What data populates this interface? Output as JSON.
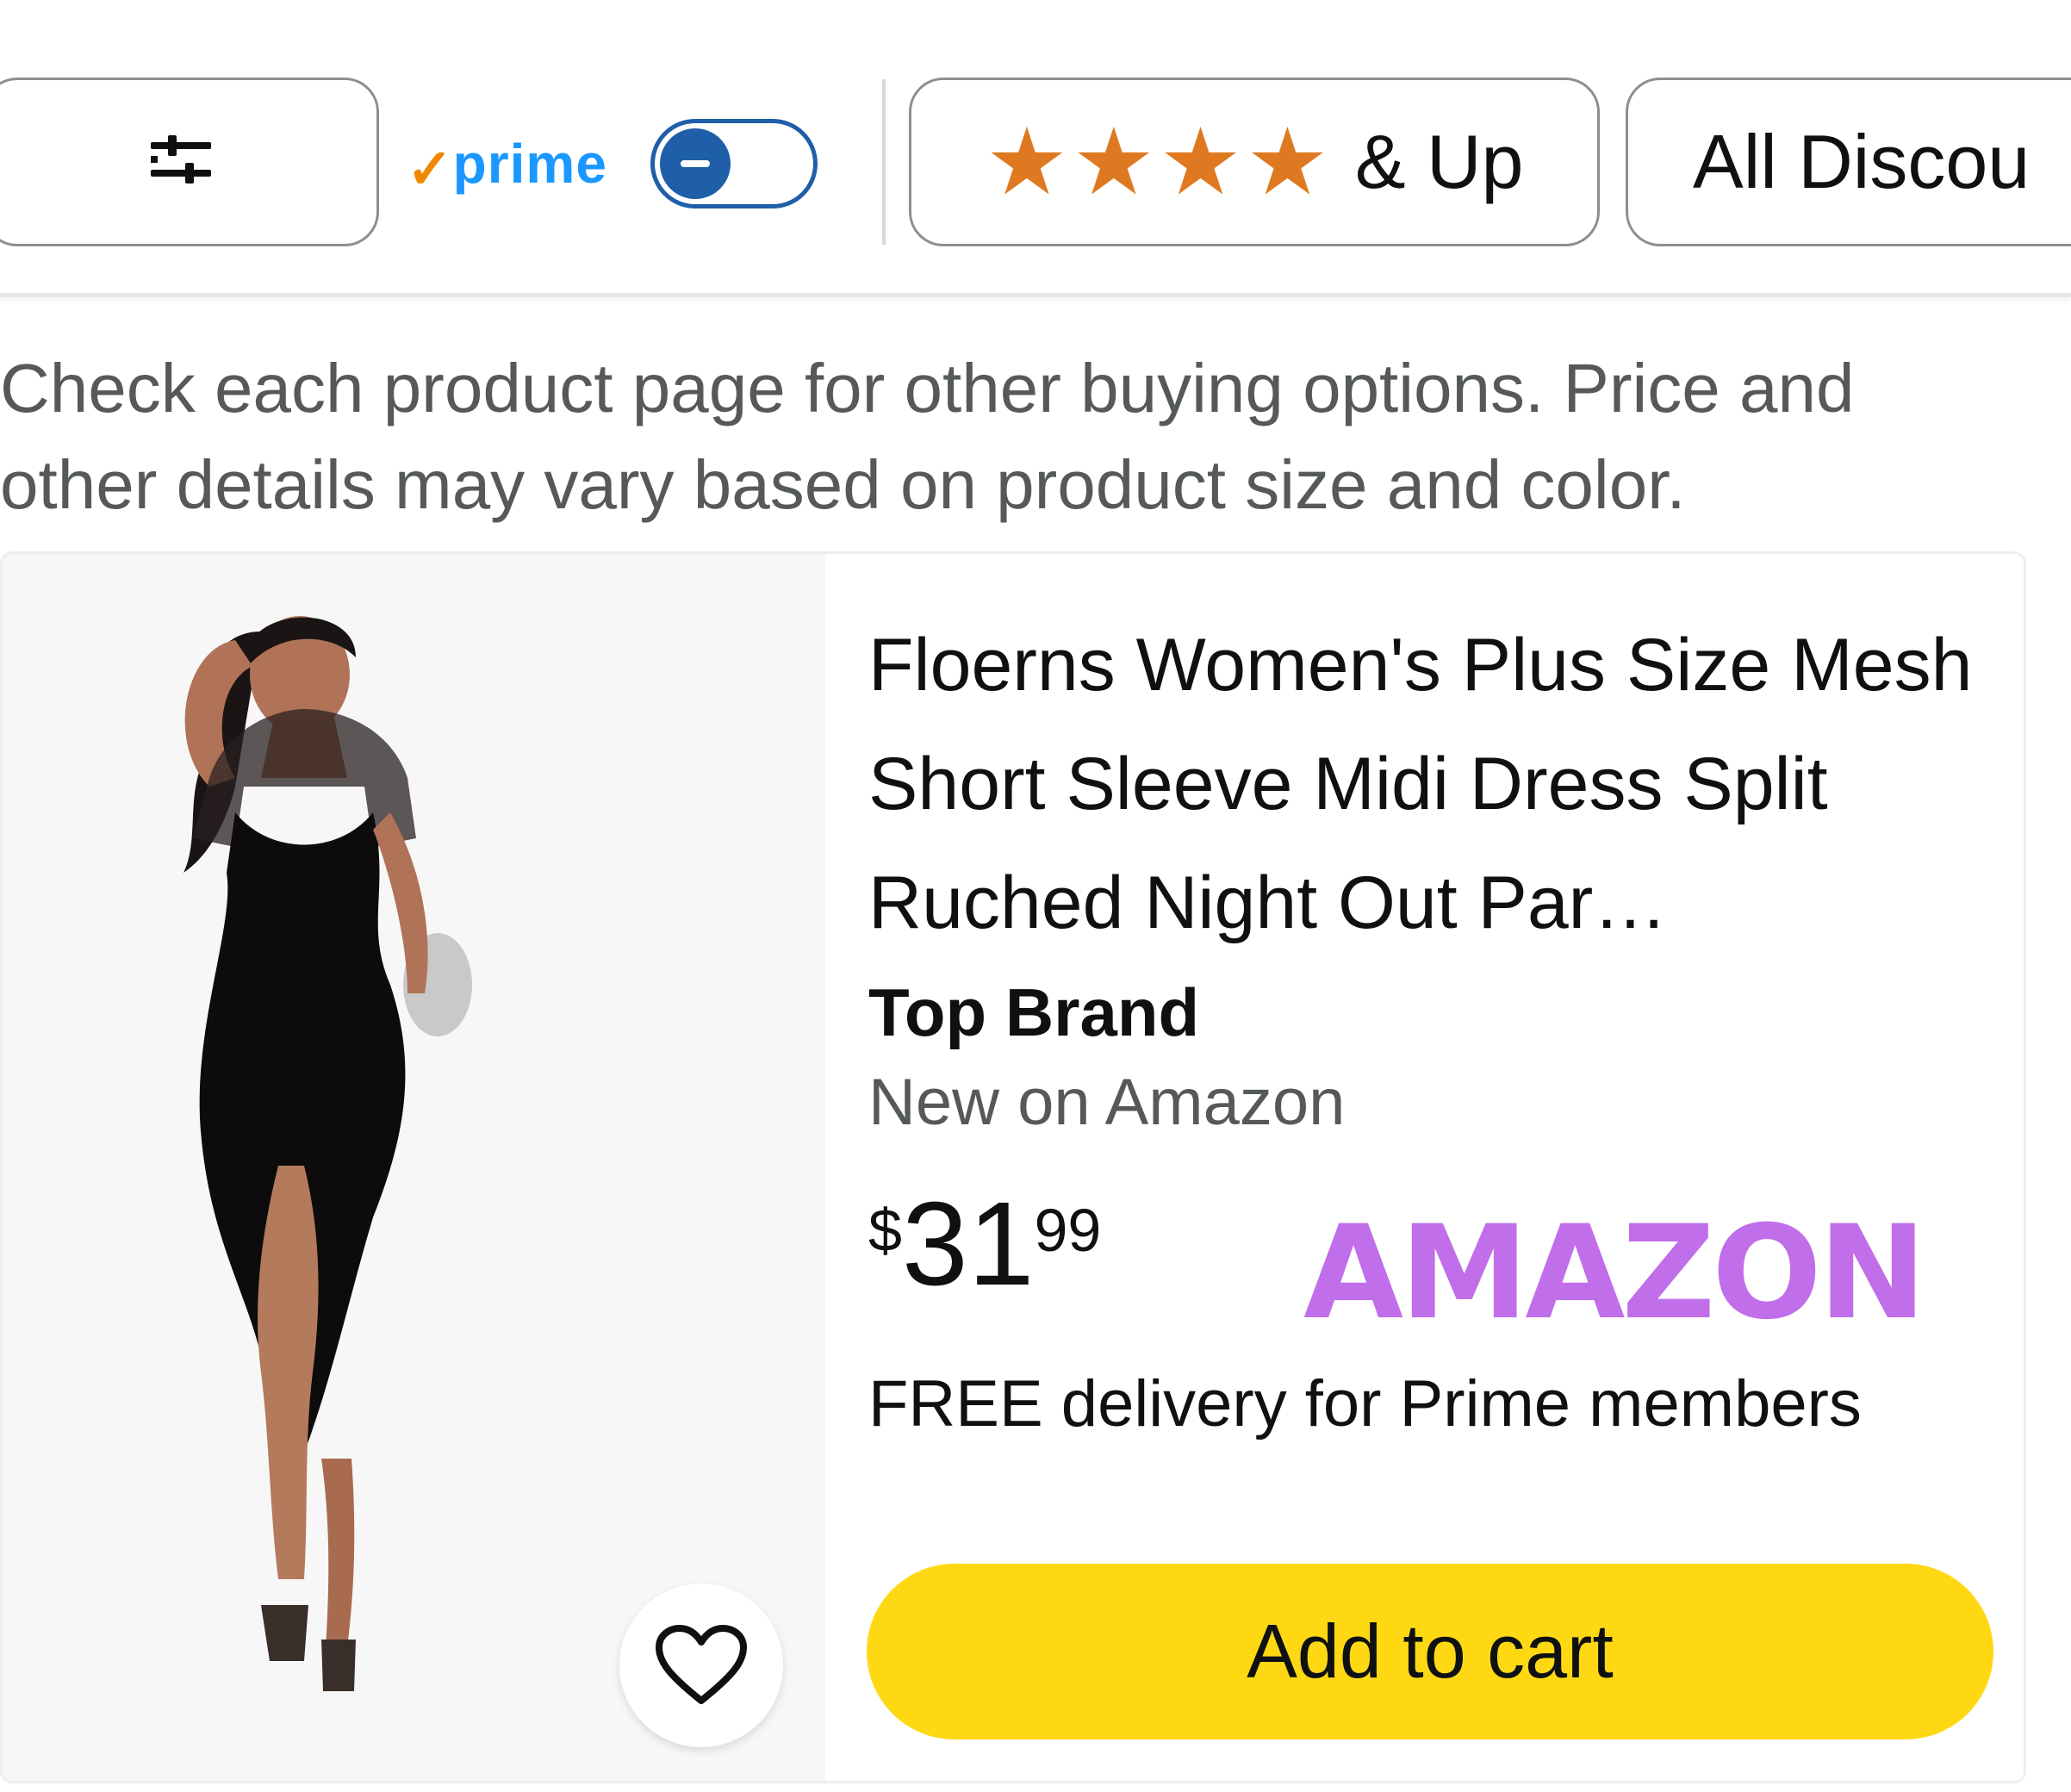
{
  "filters": {
    "filter_icon": "sliders-icon",
    "prime_check": "✓",
    "prime_label": "prime",
    "prime_toggle_state": "off",
    "stars_count": 4,
    "rating_label": "& Up",
    "discount_label": "All Discou"
  },
  "disclaimer": "Check each product page for other buying options. Price and other details may vary based on product size and color.",
  "product": {
    "title": "Floerns Women's Plus Size Mesh Short Sleeve Midi Dress Split Ruched Night Out Par…",
    "brand_badge": "Top Brand",
    "new_label": "New on Amazon",
    "price_symbol": "$",
    "price_whole": "31",
    "price_fraction": "99",
    "watermark": "AMAZON",
    "delivery": "FREE delivery for Prime members",
    "add_to_cart": "Add to cart",
    "wishlist_icon": "heart-icon"
  },
  "colors": {
    "star": "#de7921",
    "prime_blue": "#1a98ff",
    "toggle_blue": "#1f5ea8",
    "cart_button": "#ffd814",
    "watermark": "#c06ee9"
  }
}
